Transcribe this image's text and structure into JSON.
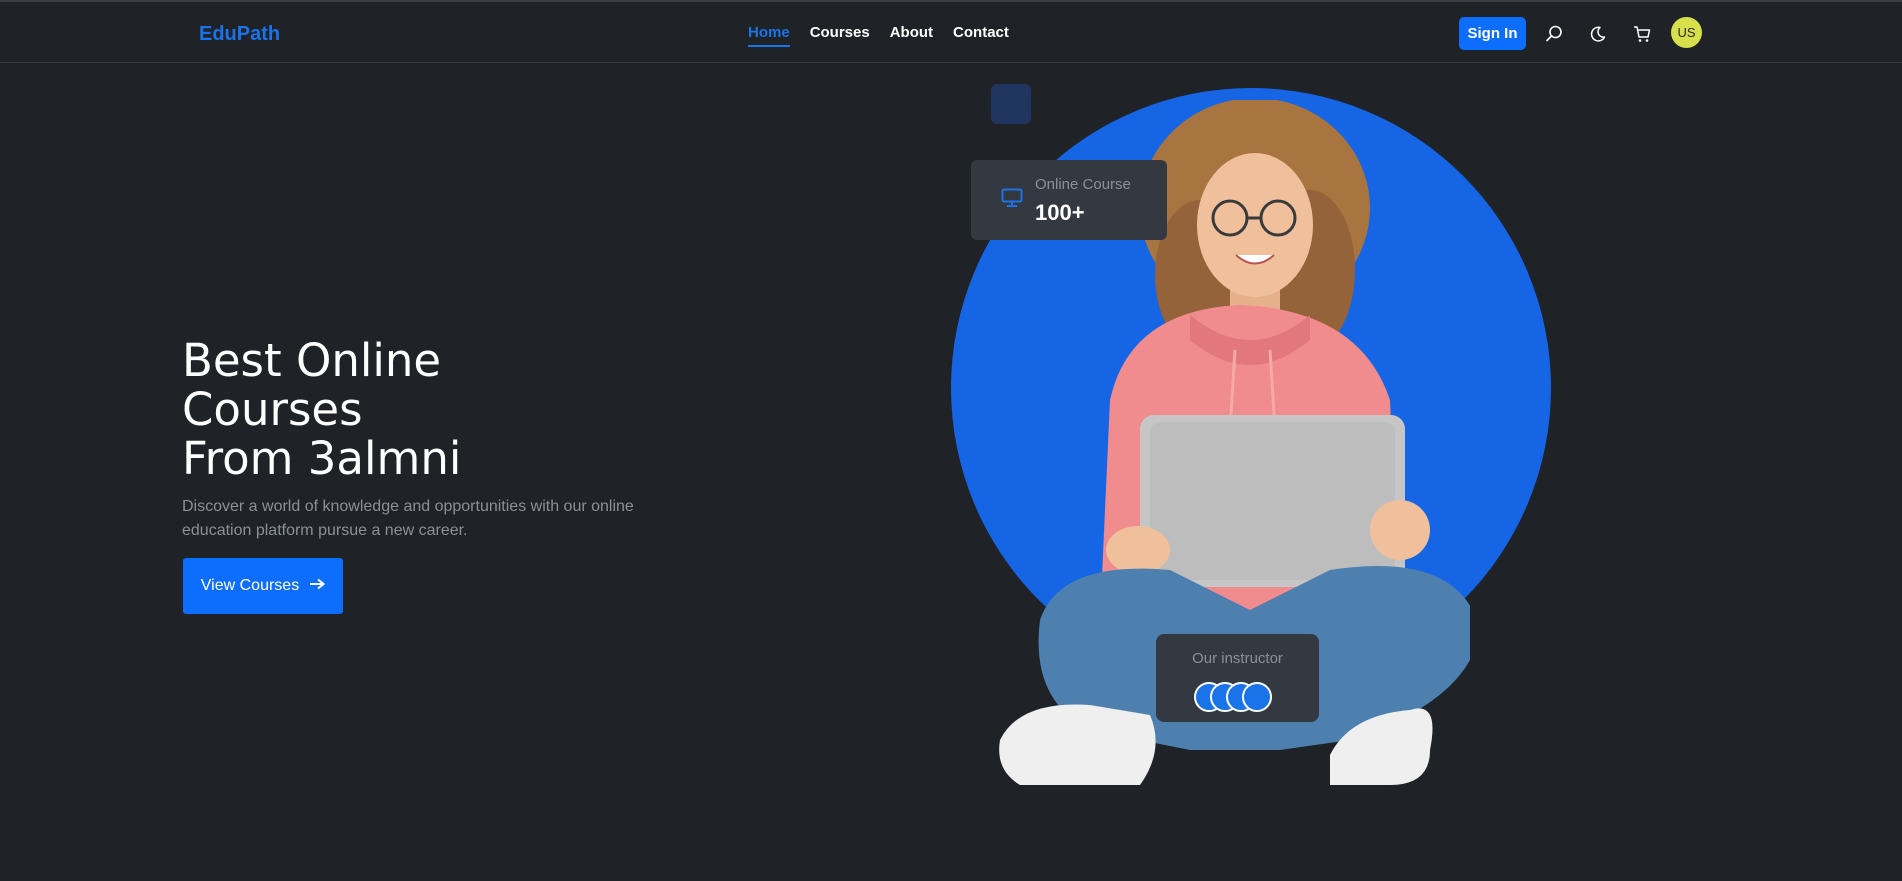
{
  "navbar": {
    "brand": "EduPath",
    "links": [
      {
        "label": "Home",
        "active": true
      },
      {
        "label": "Courses",
        "active": false
      },
      {
        "label": "About",
        "active": false
      },
      {
        "label": "Contact",
        "active": false
      }
    ],
    "sign_in": "Sign In",
    "icons": [
      "search-icon",
      "moon-icon",
      "cart-icon"
    ],
    "avatar_initials": "US"
  },
  "hero": {
    "title_lines": [
      "Best Online",
      "Courses",
      "From 3almni"
    ],
    "description": "Discover a world of knowledge and opportunities with our online education platform pursue a new career.",
    "cta_label": "View Courses",
    "cta_icon": "arrow-right-icon"
  },
  "stat_card": {
    "icon": "monitor-icon",
    "label": "Online Course",
    "value": "100+"
  },
  "instructor_card": {
    "label": "Our instructor",
    "avatar_count": 4
  },
  "colors": {
    "background": "#1f2227",
    "accent": "#0d6efd",
    "brand": "#1a73e8",
    "circle": "#1565e5",
    "card": "#343941",
    "avatar": "#d7df4a"
  }
}
